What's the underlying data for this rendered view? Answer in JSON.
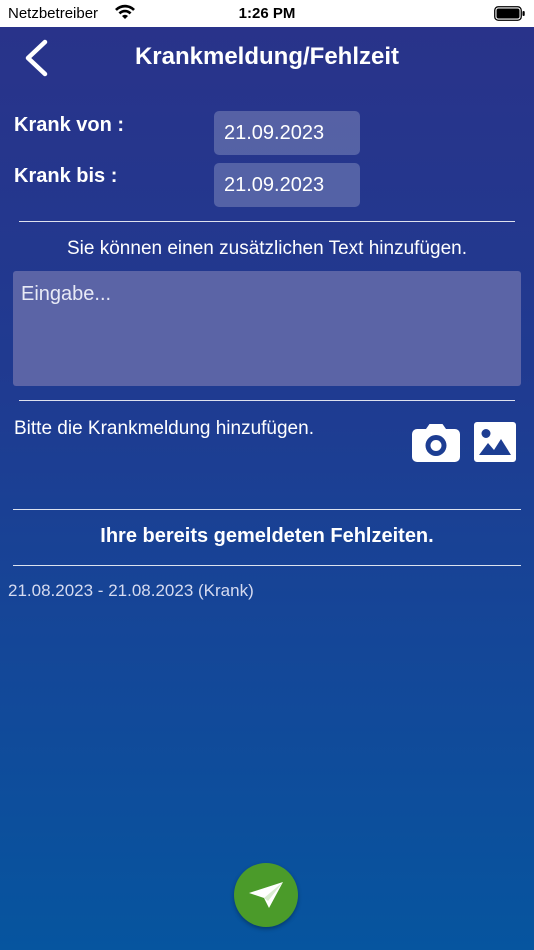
{
  "status_bar": {
    "carrier": "Netzbetreiber",
    "time": "1:26 PM"
  },
  "header": {
    "title": "Krankmeldung/Fehlzeit",
    "back_icon": "chevron-left-icon"
  },
  "form": {
    "from_label": "Krank von :",
    "from_value": "21.09.2023",
    "to_label": "Krank bis :",
    "to_value": "21.09.2023",
    "text_hint": "Sie können einen zusätzlichen Text hinzufügen.",
    "text_placeholder": "Eingabe...",
    "attachment_label": "Bitte die Krankmeldung hinzufügen.",
    "attachment_icons": [
      "camera-icon",
      "image-icon"
    ]
  },
  "absences": {
    "title": "Ihre bereits gemeldeten Fehlzeiten.",
    "entries": [
      "21.08.2023 - 21.08.2023 (Krank)"
    ]
  },
  "colors": {
    "background_top": "#29338a",
    "background_bottom": "#06559f",
    "send_button": "#4b9b2a"
  },
  "send_icon": "paper-plane-icon"
}
